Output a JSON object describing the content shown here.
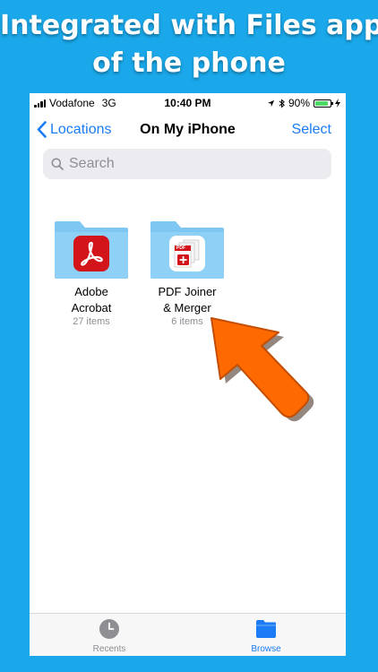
{
  "headline": {
    "line1": "Integrated with Files app",
    "line2": "of the phone"
  },
  "status_bar": {
    "carrier": "Vodafone",
    "network": "3G",
    "time": "10:40 PM",
    "battery": "90%"
  },
  "nav": {
    "back_label": "Locations",
    "title": "On My iPhone",
    "select_label": "Select"
  },
  "search": {
    "placeholder": "Search"
  },
  "folders": [
    {
      "name_line1": "Adobe",
      "name_line2": "Acrobat",
      "count": "27 items",
      "icon": "adobe-acrobat-icon"
    },
    {
      "name_line1": "PDF Joiner",
      "name_line2": "& Merger",
      "count": "6 items",
      "icon": "pdf-joiner-icon"
    }
  ],
  "badge_text": "PDF",
  "tabs": [
    {
      "label": "Recents",
      "icon": "clock-icon"
    },
    {
      "label": "Browse",
      "icon": "folder-icon"
    }
  ],
  "colors": {
    "background": "#1aa8ea",
    "accent": "#1b7cf5",
    "folder": "#7fc7f3",
    "arrow": "#ff6a00",
    "acrobat_red": "#d4141b"
  }
}
